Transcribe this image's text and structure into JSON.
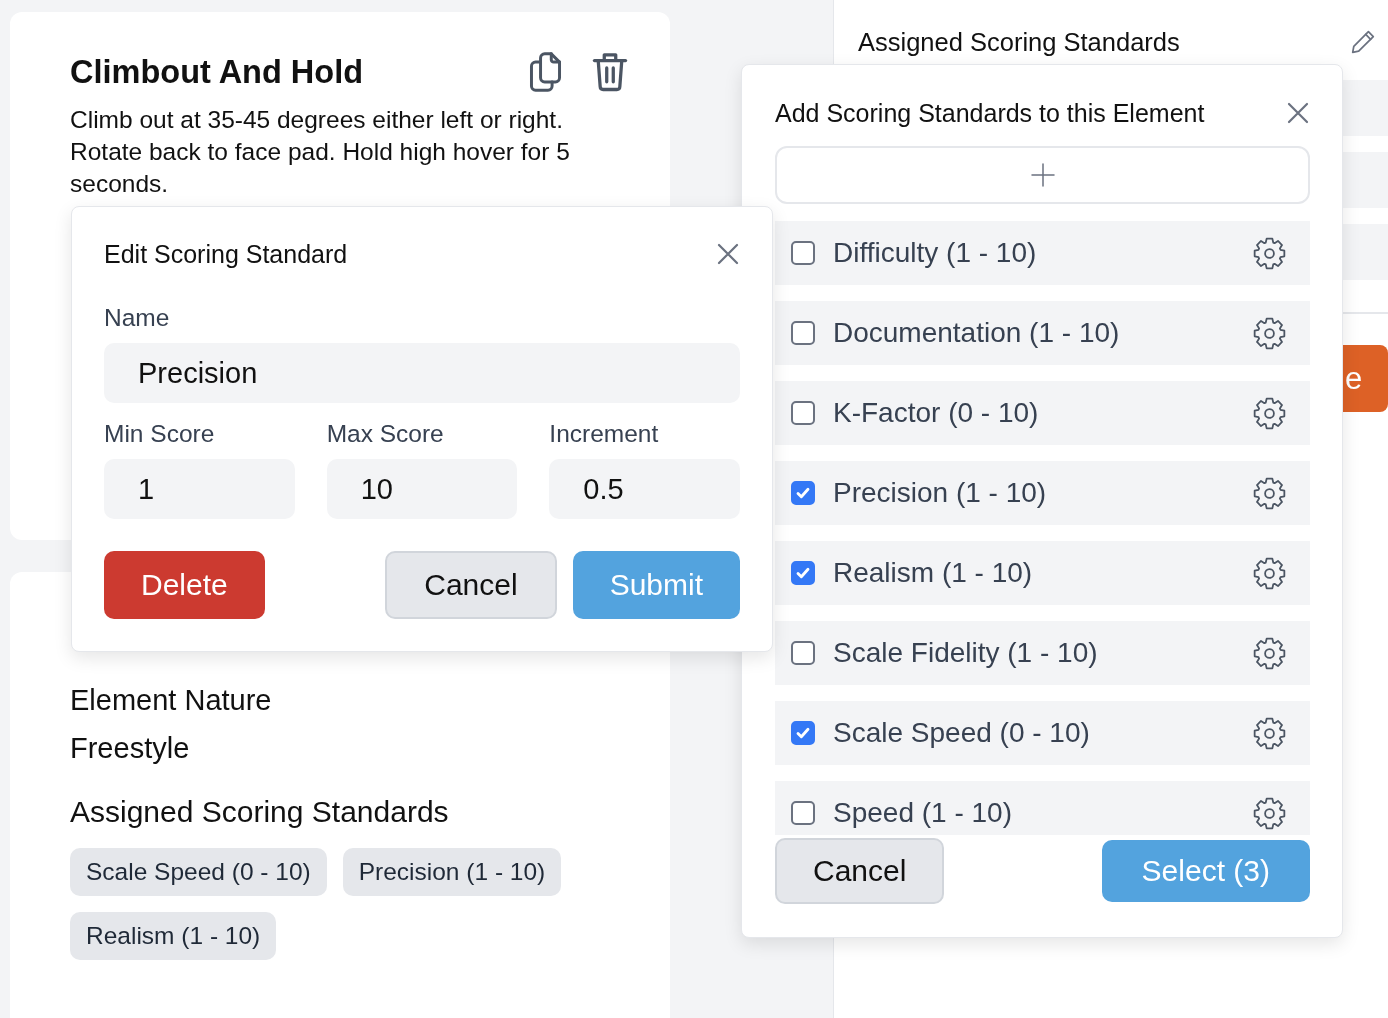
{
  "element_card": {
    "title": "Climbout And Hold",
    "description": "Climb out at 35-45 degrees either left or right. Rotate back to face pad. Hold high hover for 5 seconds."
  },
  "details_card": {
    "nature_label": "Element Nature",
    "nature_value": "Freestyle",
    "standards_label": "Assigned Scoring Standards",
    "standards": [
      "Scale Speed (0 - 10)",
      "Precision (1 - 10)",
      "Realism (1 - 10)"
    ]
  },
  "side_panel": {
    "title": "Assigned Scoring Standards",
    "action_button": "e"
  },
  "edit_dialog": {
    "title": "Edit Scoring Standard",
    "name_field": {
      "label": "Name",
      "value": "Precision"
    },
    "score_fields": [
      {
        "label": "Min Score",
        "value": "1"
      },
      {
        "label": "Max Score",
        "value": "10"
      },
      {
        "label": "Increment",
        "value": "0.5"
      }
    ],
    "buttons": [
      {
        "kind": "danger",
        "label": "Delete"
      },
      {
        "kind": "secondary",
        "label": "Cancel"
      },
      {
        "kind": "primary",
        "label": "Submit"
      }
    ]
  },
  "add_dialog": {
    "title": "Add Scoring Standards to this Element",
    "items": [
      {
        "label": "Difficulty (1 - 10)",
        "checked": false
      },
      {
        "label": "Documentation (1 - 10)",
        "checked": false
      },
      {
        "label": "K-Factor (0 - 10)",
        "checked": false
      },
      {
        "label": "Precision (1 - 10)",
        "checked": true
      },
      {
        "label": "Realism (1 - 10)",
        "checked": true
      },
      {
        "label": "Scale Fidelity (1 - 10)",
        "checked": false
      },
      {
        "label": "Scale Speed (0 - 10)",
        "checked": true
      },
      {
        "label": "Speed (1 - 10)",
        "checked": false
      }
    ],
    "buttons": [
      {
        "kind": "secondary",
        "label": "Cancel"
      },
      {
        "kind": "primary",
        "label": "Select (3)"
      }
    ]
  }
}
